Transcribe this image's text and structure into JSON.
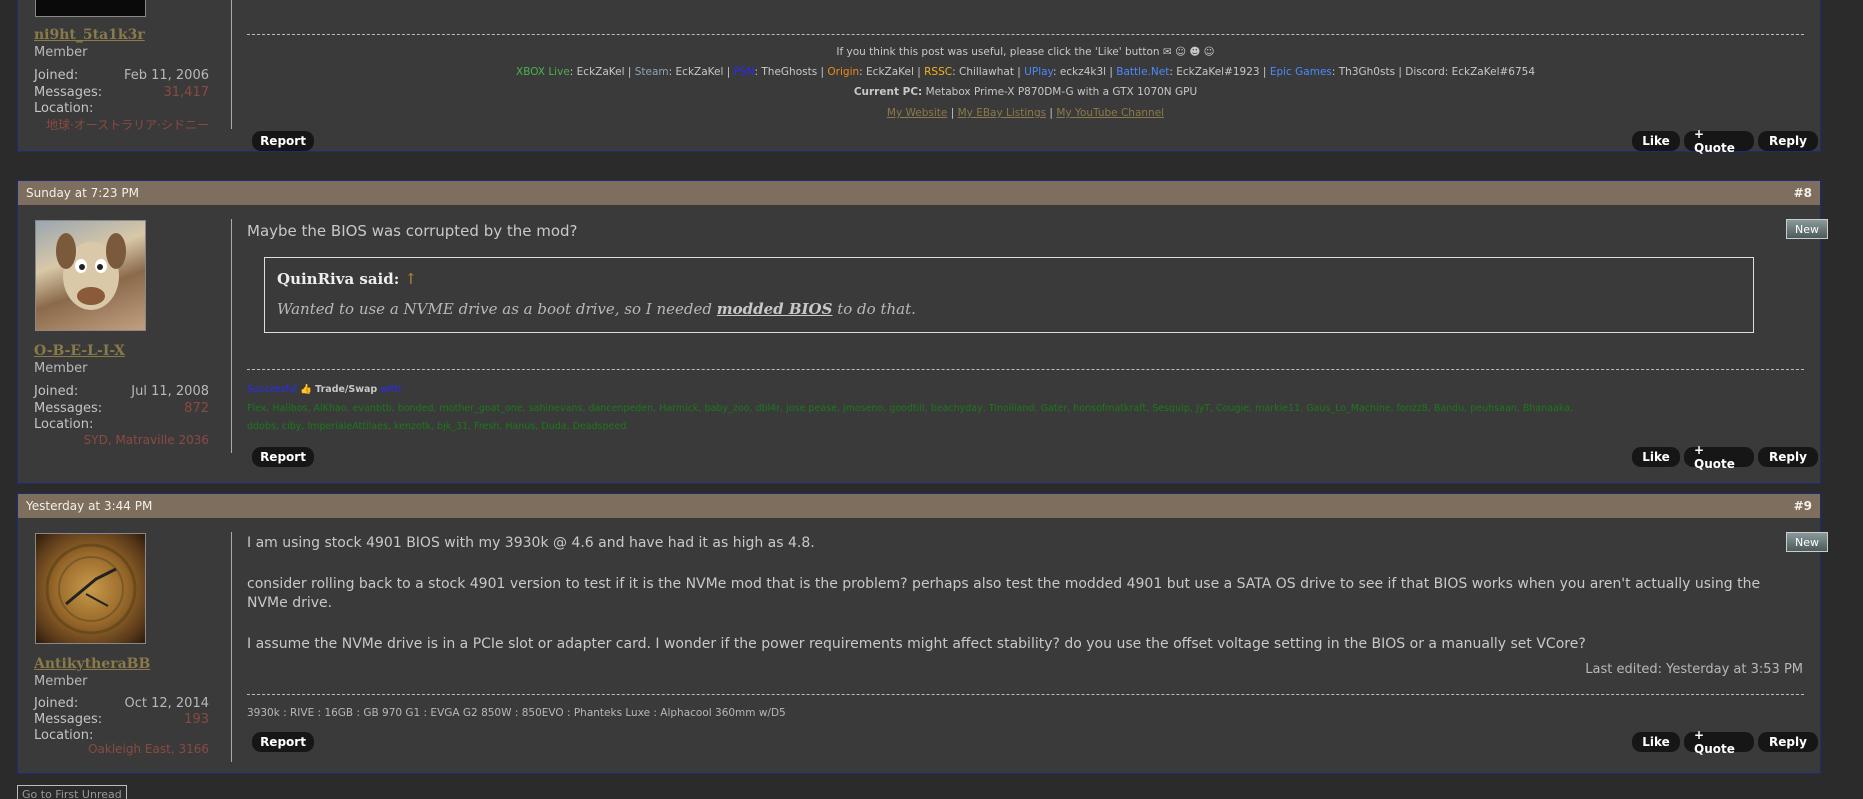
{
  "post7": {
    "user": {
      "name": "ni9ht_5ta1k3r",
      "role": "Member",
      "joined_label": "Joined:",
      "joined": "Feb 11, 2006",
      "messages_label": "Messages:",
      "messages": "31,417",
      "location_label": "Location:",
      "location": "地球·オーストラリア·シドニー"
    },
    "sig": {
      "like_text": "If you think this post was useful, please click the 'Like' button",
      "gaming": [
        {
          "label": "XBOX Live",
          "value": "EckZaKel",
          "color": "#4caf50"
        },
        {
          "label": "Steam",
          "value": "EckZaKel",
          "color": "#8fa4b8"
        },
        {
          "label": "PSN",
          "value": "TheGhosts",
          "color": "#2a2aff"
        },
        {
          "label": "Origin",
          "value": "EckZaKel",
          "color": "#f08a1c"
        },
        {
          "label": "RSSC",
          "value": "Chillawhat",
          "color": "#f5b21c"
        },
        {
          "label": "UPlay",
          "value": "eckz4k3l",
          "color": "#4a8aff"
        },
        {
          "label": "Battle.Net",
          "value": "EckZaKel#1923",
          "color": "#4a8aff"
        },
        {
          "label": "Epic Games",
          "value": "Th3Gh0sts",
          "color": "#4a8aff"
        },
        {
          "label": "Discord",
          "value": "EckZaKel#6754",
          "color": "#c8c8c8"
        }
      ],
      "pc_label": "Current PC:",
      "pc": "Metabox Prime-X P870DM-G with a GTX 1070N GPU",
      "links": [
        "My Website",
        "My EBay Listings",
        "My YouTube Channel"
      ]
    },
    "actions": {
      "report": "Report",
      "like": "Like",
      "quote": "+ Quote",
      "reply": "Reply"
    }
  },
  "post8": {
    "date": "Sunday at 7:23 PM",
    "number": "#8",
    "new_label": "New",
    "user": {
      "name": "O-B-E-L-I-X",
      "role": "Member",
      "joined_label": "Joined:",
      "joined": "Jul 11, 2008",
      "messages_label": "Messages:",
      "messages": "872",
      "location_label": "Location:",
      "location": "SYD, Matraville 2036"
    },
    "message": "Maybe the BIOS was corrupted by the mod?",
    "quote": {
      "author": "QuinRiva said:",
      "arrow": "↑",
      "text_before": "Wanted to use a NVME drive as a boot drive, so I needed ",
      "text_bold": "modded BIOS",
      "text_after": " to do that."
    },
    "sig": {
      "successful": "Successful",
      "trade": "Trade/Swap",
      "with": "with:",
      "names1": "Flex, Halibos, AlKhao, evanbtb, bonded, mother_goat_one, sahinevans, dancenpeden, Harmick, baby_zoo, dbl4r, jose pease, jmoseno, goodtill, beachyday, Tinolliand, Gater, honsofmatkraft, Sesquip, JyT, Cougie, markie11, Gaus_Lo_Machine, fonzz8, Bandu, peuhsaan, Bhanaaka,",
      "names2": "ddobs, ciby, ImperialeAttilaes, kenzotk, bjk_31, Fresh, Hanus, Duda, Deadspeed"
    },
    "actions": {
      "report": "Report",
      "like": "Like",
      "quote": "+ Quote",
      "reply": "Reply"
    }
  },
  "post9": {
    "date": "Yesterday at 3:44 PM",
    "number": "#9",
    "new_label": "New",
    "user": {
      "name": "AntikytheraBB",
      "role": "Member",
      "joined_label": "Joined:",
      "joined": "Oct 12, 2014",
      "messages_label": "Messages:",
      "messages": "193",
      "location_label": "Location:",
      "location": "Oakleigh East, 3166"
    },
    "paragraphs": [
      "I am using stock 4901 BIOS with my 3930k @ 4.6 and have had it as high as 4.8.",
      "consider rolling back to a stock 4901 version to test if it is the NVMe mod that is the problem? perhaps also test the modded 4901 but use a SATA OS drive to see if that BIOS works when you aren't actually using the NVMe drive.",
      "I assume the NVMe drive is in a PCIe slot or adapter card. I wonder if the power requirements might affect stability? do you use the offset voltage setting in the BIOS or a manually set VCore?"
    ],
    "last_edited": "Last edited: Yesterday at 3:53 PM",
    "sig": "3930k : RIVE : 16GB : GB 970 G1 : EVGA G2 850W : 850EVO : Phanteks Luxe : Alphacool 360mm w/D5",
    "actions": {
      "report": "Report",
      "like": "Like",
      "quote": "+ Quote",
      "reply": "Reply"
    }
  },
  "footer": {
    "goto": "Go to First Unread"
  }
}
